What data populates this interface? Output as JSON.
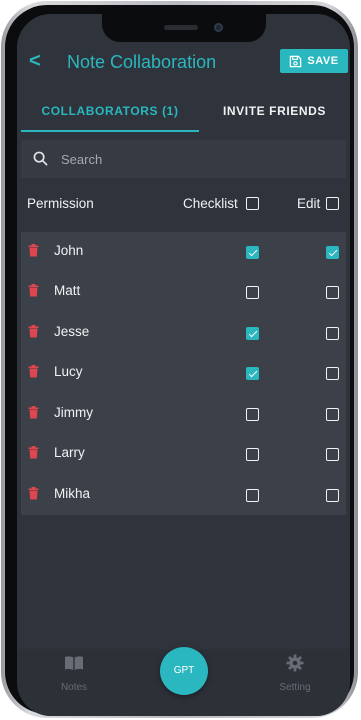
{
  "header": {
    "back_label": "<",
    "title": "Note Collaboration",
    "save_label": "SAVE"
  },
  "tabs": [
    {
      "label": "COLLABORATORS (1)",
      "active": true
    },
    {
      "label": "INVITE FRIENDS",
      "active": false
    }
  ],
  "search": {
    "placeholder": "Search",
    "value": ""
  },
  "permissions": {
    "label": "Permission",
    "checklist_label": "Checklist",
    "checklist_all": false,
    "edit_label": "Edit",
    "edit_all": false
  },
  "collaborators": [
    {
      "name": "John",
      "checklist": true,
      "edit": true
    },
    {
      "name": "Matt",
      "checklist": false,
      "edit": false
    },
    {
      "name": "Jesse",
      "checklist": true,
      "edit": false
    },
    {
      "name": "Lucy",
      "checklist": true,
      "edit": false
    },
    {
      "name": "Jimmy",
      "checklist": false,
      "edit": false
    },
    {
      "name": "Larry",
      "checklist": false,
      "edit": false
    },
    {
      "name": "Mikha",
      "checklist": false,
      "edit": false
    }
  ],
  "bottom_nav": {
    "notes_label": "Notes",
    "setting_label": "Setting",
    "gpt_label": "GPT",
    "notes_icon": "book-icon",
    "setting_icon": "gear-icon"
  },
  "colors": {
    "accent": "#2ab7bf",
    "background": "#2f333b",
    "list_background": "#3c4049",
    "delete": "#e0464f"
  }
}
